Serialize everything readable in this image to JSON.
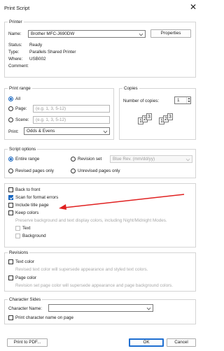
{
  "window": {
    "title": "Print Script",
    "close_glyph": "✕"
  },
  "printer": {
    "legend": "Printer",
    "name_label": "Name:",
    "name_value": "Brother MFC-J690DW",
    "properties_label": "Properties",
    "status_label": "Status:",
    "status_value": "Ready",
    "type_label": "Type:",
    "type_value": "Parallels Shared Printer",
    "where_label": "Where:",
    "where_value": "USB002",
    "comment_label": "Comment:"
  },
  "print_range": {
    "legend": "Print range",
    "all_label": "All",
    "page_label": "Page:",
    "page_placeholder": "(e.g. 1, 3, 5-12)",
    "scene_label": "Scene:",
    "scene_placeholder": "(e.g. 1, 3, 5-12)",
    "print_label": "Print:",
    "print_value": "Odds & Evens"
  },
  "copies": {
    "legend": "Copies",
    "number_label": "Number of copies:",
    "number_value": "1",
    "collate_a": [
      "1",
      "2",
      "3"
    ],
    "collate_b": [
      "1",
      "2",
      "3"
    ]
  },
  "script_options": {
    "legend": "Script options",
    "entire_range": "Entire range",
    "revision_set": "Revision set",
    "revision_set_value": "Blue Rev. (mm/dd/yy)",
    "revised_pages_only": "Revised pages only",
    "unrevised_pages_only": "Unrevised pages only"
  },
  "options": {
    "back_to_front": "Back to front",
    "scan_for_format_errors": "Scan for format errors",
    "include_title_page": "Include title page",
    "keep_colors": "Keep colors",
    "preserve_note": "Preserve background and text display colors, including Night/Midnight Modes.",
    "text": "Text",
    "background": "Background"
  },
  "revisions": {
    "legend": "Revisions",
    "text_color": "Text color",
    "text_color_note": "Revised text color will supersede appearance and styled text colors.",
    "page_color": "Page color",
    "page_color_note": "Revision set page color will supersede appearance and page background colors."
  },
  "character_sides": {
    "legend": "Character Sides",
    "character_name_label": "Character Name:",
    "character_name_value": "",
    "print_character_name": "Print character name on page"
  },
  "footer": {
    "print_to_pdf": "Print to PDF...",
    "ok": "OK",
    "cancel": "Cancel"
  },
  "colors": {
    "accent": "#1565c0",
    "annotation_arrow": "#e02020",
    "disabled_text": "#a8a8a8"
  },
  "checked": {
    "all": true,
    "page": false,
    "scene": false,
    "entire_range": true,
    "revision_set": false,
    "revised_pages_only": false,
    "unrevised_pages_only": false,
    "back_to_front": false,
    "scan_for_format_errors": true,
    "include_title_page": false,
    "keep_colors": false,
    "text": false,
    "background": false,
    "text_color": false,
    "page_color": false,
    "print_character_name": false
  }
}
